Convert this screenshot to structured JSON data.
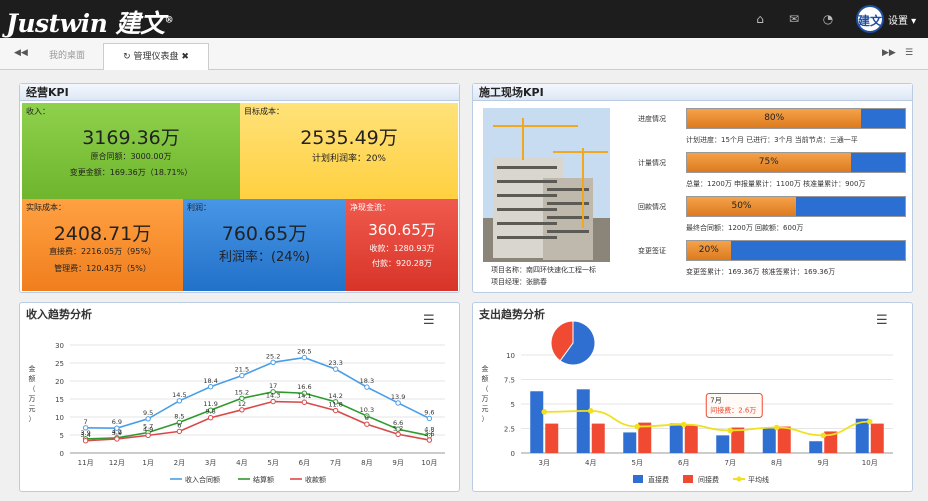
{
  "app": {
    "logo_text": "Justwin",
    "logo_cn": "建文",
    "logo_reg": "®",
    "avatar_text": "建文",
    "settings_label": "设置"
  },
  "tabs": [
    {
      "label": "我的桌面"
    },
    {
      "label": "管理仪表盘"
    }
  ],
  "kpi": {
    "title": "经营KPI",
    "income": {
      "label": "收入：",
      "value": "3169.36万",
      "line1": "原合同额：3000.00万",
      "line2": "变更金额：169.36万（18.71%）"
    },
    "target": {
      "label": "目标成本：",
      "value": "2535.49万",
      "line1": "计划利润率：20%"
    },
    "actual": {
      "label": "实际成本：",
      "value": "2408.71万",
      "line1": "直接费：2216.05万（95%）",
      "line2": "管理费：120.43万（5%）"
    },
    "profit": {
      "label": "利润：",
      "value": "760.65万",
      "line1": "利润率：(24%)"
    },
    "cash": {
      "label": "净现金流：",
      "value": "360.65万",
      "line1": "收款：1280.93万",
      "line2": "付款：920.28万"
    },
    "colors": {
      "income": "#7cc33f",
      "target": "#ffd650",
      "actual": "#f58c2a",
      "profit": "#2f82d6",
      "cash": "#e8443a"
    }
  },
  "site": {
    "title": "施工现场KPI",
    "caption1": "项目名称：南四环快速化工程一标",
    "caption2": "项目经理：张鹏春",
    "rows": [
      {
        "label": "进度情况",
        "percent_text": "80%",
        "fill": 0.8,
        "detail": "计划进度：15个月   已进行：3个月   当前节点：三通一平"
      },
      {
        "label": "计量情况",
        "percent_text": "75%",
        "fill": 0.75,
        "detail": "总量：1200万   申报量累计：1100万   核准量累计：900万"
      },
      {
        "label": "回款情况",
        "percent_text": "50%",
        "fill": 0.5,
        "detail": "最终合同额：1200万   回款额：600万"
      },
      {
        "label": "变更签证",
        "percent_text": "20%",
        "fill": 0.2,
        "detail": "变更签累计：169.36万      核准签累计：169.36万"
      }
    ]
  },
  "chart_data": [
    {
      "type": "line",
      "title": "收入趋势分析",
      "ylabel": "金额（万元）",
      "categories": [
        "11月",
        "12月",
        "1月",
        "2月",
        "3月",
        "4月",
        "5月",
        "6月",
        "7月",
        "8月",
        "9月",
        "10月"
      ],
      "ylim": [
        0,
        30
      ],
      "yticks": [
        0,
        5,
        10,
        15,
        20,
        25,
        30
      ],
      "legend": "bottom",
      "series": [
        {
          "name": "收入合同额",
          "color": "#4a9ee8",
          "values": [
            7,
            6.9,
            9.5,
            14.5,
            18.4,
            21.5,
            25.2,
            26.5,
            23.3,
            18.3,
            13.9,
            9.6
          ]
        },
        {
          "name": "结算额",
          "color": "#2e9a2e",
          "values": [
            3.9,
            4.2,
            5.7,
            8.5,
            11.9,
            15.2,
            17,
            16.6,
            14.2,
            10.3,
            6.6,
            4.8
          ]
        },
        {
          "name": "收款额",
          "color": "#d84a4a",
          "values": [
            3.4,
            3.9,
            4.9,
            6,
            9.8,
            12,
            14.3,
            14.1,
            11.8,
            8,
            5.2,
            3.6
          ]
        }
      ]
    },
    {
      "type": "bar",
      "title": "支出趋势分析",
      "ylabel": "金额（万元）",
      "categories": [
        "3月",
        "4月",
        "5月",
        "6月",
        "7月",
        "8月",
        "9月",
        "10月"
      ],
      "ylim": [
        0,
        10
      ],
      "yticks": [
        0,
        2.5,
        5,
        7.5,
        10
      ],
      "legend": "bottom",
      "tooltip": {
        "title": "7月",
        "text": "间接费：2.6万"
      },
      "series": [
        {
          "name": "直接费",
          "color": "#2e6fd1",
          "values": [
            6.3,
            6.5,
            2.1,
            3,
            1.8,
            2.5,
            1.2,
            3.5
          ]
        },
        {
          "name": "间接费",
          "color": "#f04a32",
          "values": [
            3,
            3,
            3.1,
            2.8,
            2.6,
            2.7,
            2.2,
            3
          ]
        },
        {
          "name": "平均线",
          "color": "#f0e020",
          "type": "line",
          "values": [
            4.2,
            4.3,
            2.7,
            2.9,
            2.3,
            2.6,
            1.8,
            3.2
          ]
        }
      ],
      "pie": {
        "colors": [
          "#2e6fd1",
          "#f04a32"
        ],
        "values": [
          60,
          40
        ]
      }
    }
  ]
}
